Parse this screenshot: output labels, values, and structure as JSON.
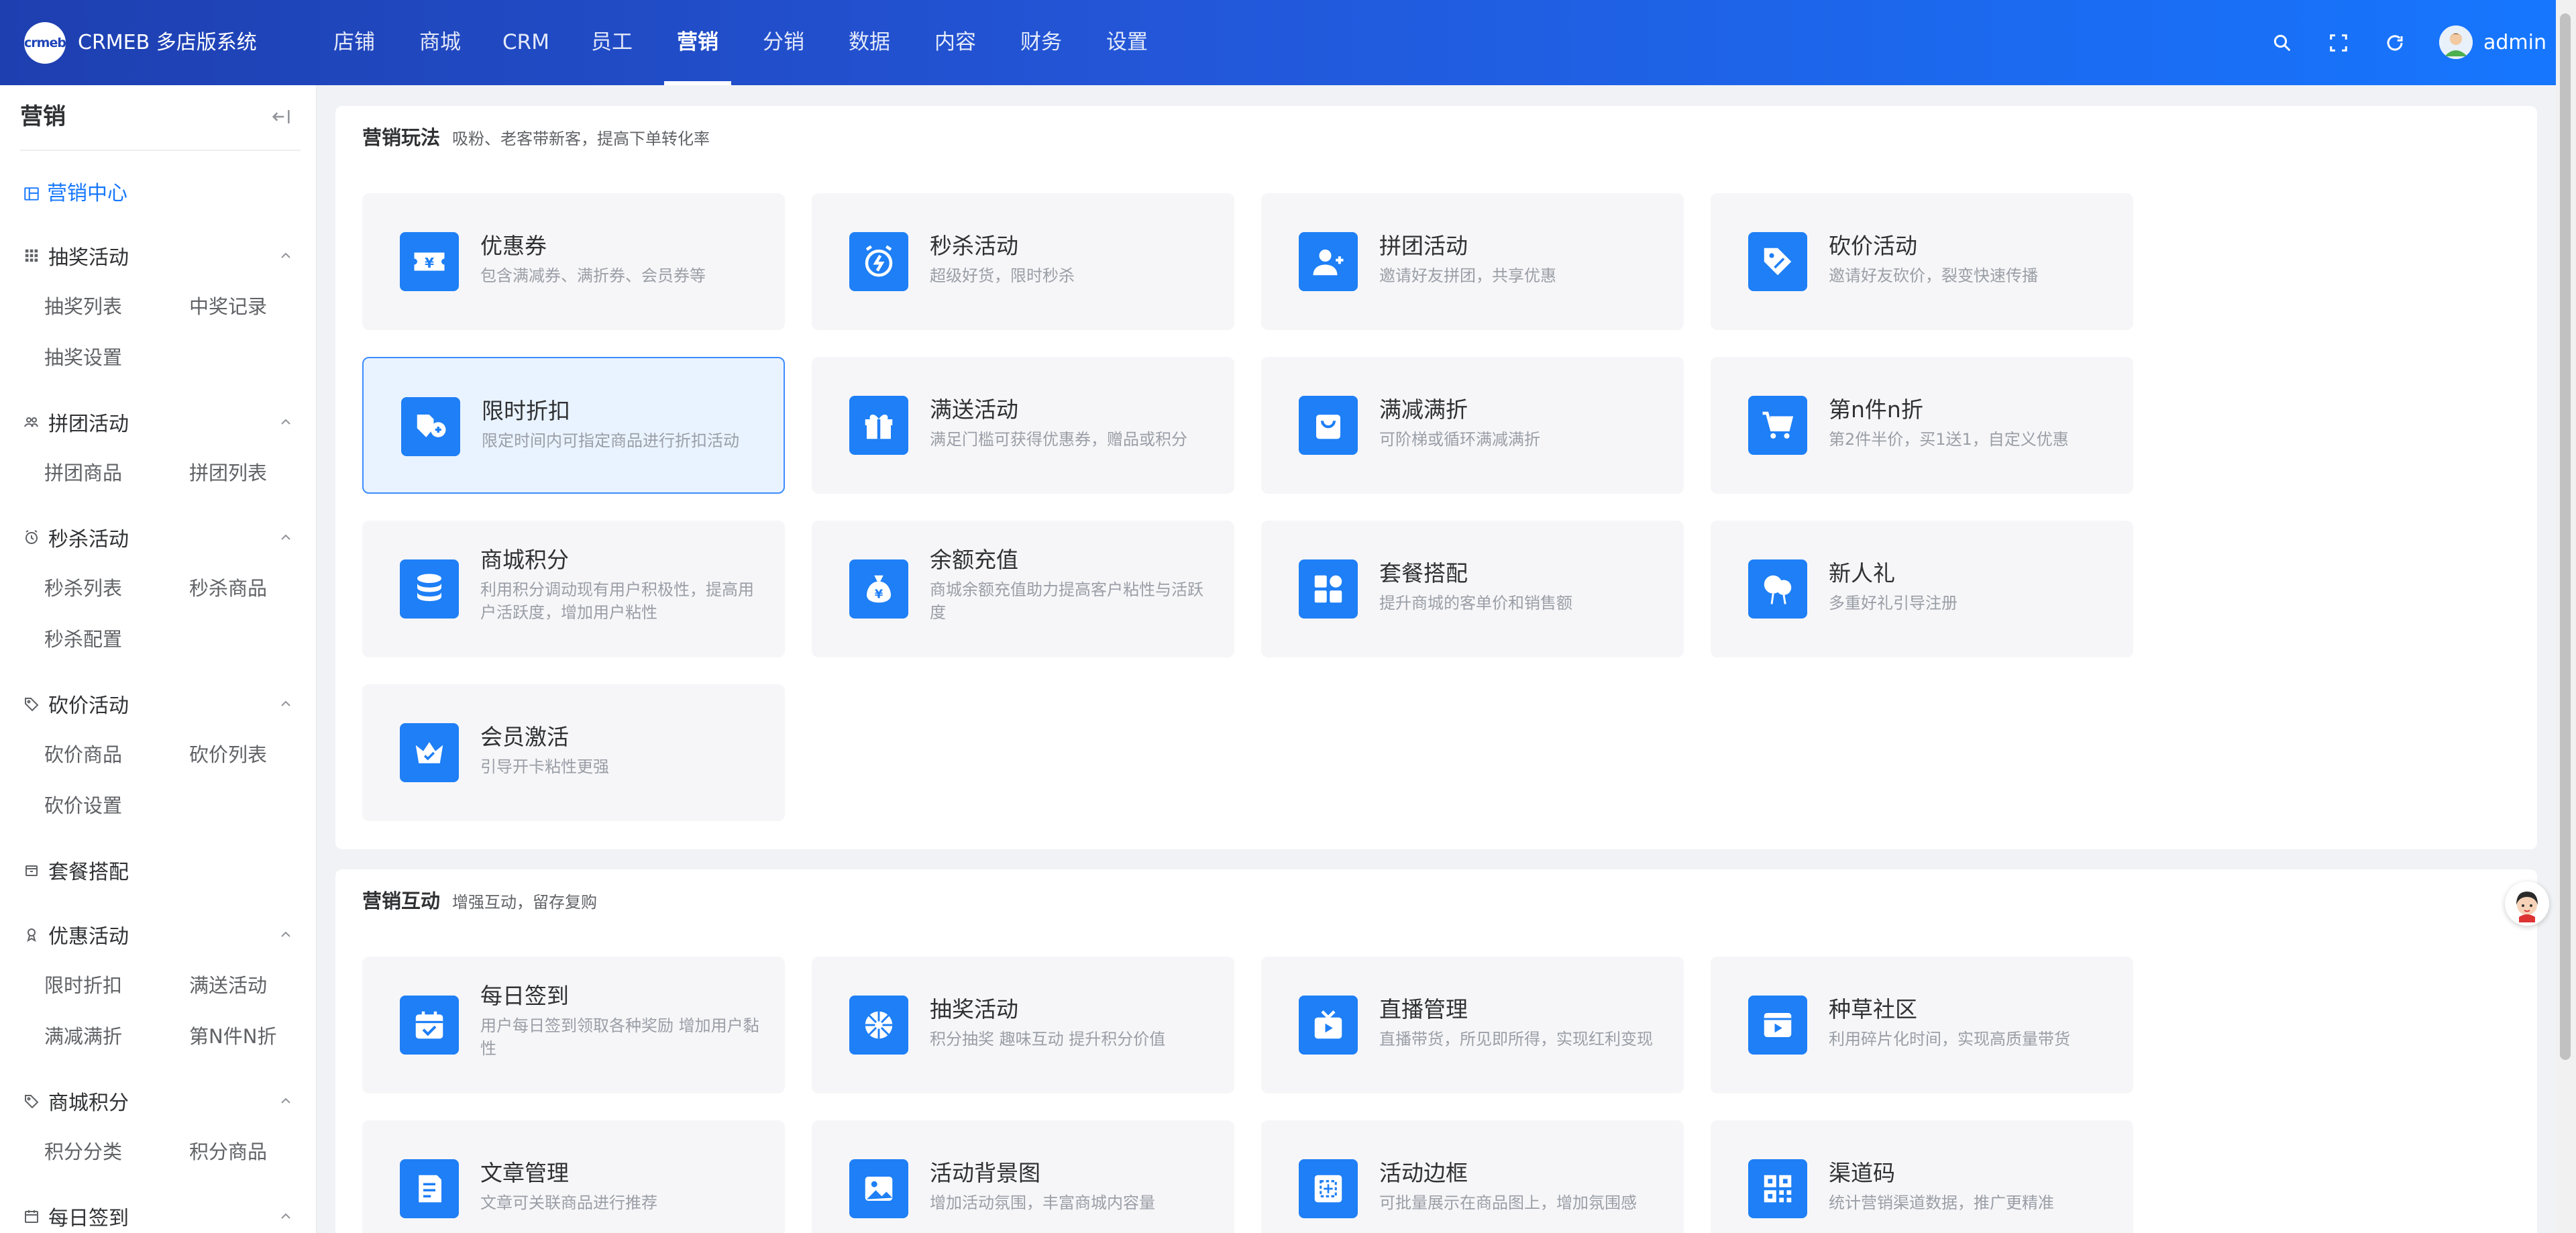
{
  "header": {
    "logo_text": "crmeb",
    "brand": "CRMEB 多店版系统",
    "nav": [
      "店铺",
      "商城",
      "CRM",
      "员工",
      "营销",
      "分销",
      "数据",
      "内容",
      "财务",
      "设置"
    ],
    "active_nav": "营销",
    "username": "admin"
  },
  "sidebar": {
    "title": "营销",
    "home": "营销中心",
    "groups": [
      {
        "label": "抽奖活动",
        "subs": [
          "抽奖列表",
          "中奖记录",
          "抽奖设置"
        ]
      },
      {
        "label": "拼团活动",
        "subs": [
          "拼团商品",
          "拼团列表"
        ]
      },
      {
        "label": "秒杀活动",
        "subs": [
          "秒杀列表",
          "秒杀商品",
          "秒杀配置"
        ]
      },
      {
        "label": "砍价活动",
        "subs": [
          "砍价商品",
          "砍价列表",
          "砍价设置"
        ]
      },
      {
        "label": "套餐搭配",
        "subs": []
      },
      {
        "label": "优惠活动",
        "subs": [
          "限时折扣",
          "满送活动",
          "满减满折",
          "第N件N折"
        ]
      },
      {
        "label": "商城积分",
        "subs": [
          "积分分类",
          "积分商品"
        ]
      },
      {
        "label": "每日签到",
        "subs": []
      }
    ]
  },
  "sections": [
    {
      "title": "营销玩法",
      "desc": "吸粉、老客带新客，提高下单转化率",
      "tiles": [
        {
          "title": "优惠券",
          "desc": "包含满减券、满折券、会员券等",
          "icon": "coupon-icon"
        },
        {
          "title": "秒杀活动",
          "desc": "超级好货，限时秒杀",
          "icon": "alarm-clock-icon"
        },
        {
          "title": "拼团活动",
          "desc": "邀请好友拼团，共享优惠",
          "icon": "group-users-icon"
        },
        {
          "title": "砍价活动",
          "desc": "邀请好友砍价，裂变快速传播",
          "icon": "price-tag-icon"
        },
        {
          "title": "限时折扣",
          "desc": "限定时间内可指定商品进行折扣活动",
          "icon": "discount-tag-icon"
        },
        {
          "title": "满送活动",
          "desc": "满足门槛可获得优惠券，赠品或积分",
          "icon": "gift-icon"
        },
        {
          "title": "满减满折",
          "desc": "可阶梯或循环满减满折",
          "icon": "shopping-bag-icon"
        },
        {
          "title": "第n件n折",
          "desc": "第2件半价，买1送1，自定义优惠",
          "icon": "cart-icon"
        },
        {
          "title": "商城积分",
          "desc": "利用积分调动现有用户积极性，提高用户活跃度，增加用户粘性",
          "icon": "coin-stack-icon"
        },
        {
          "title": "余额充值",
          "desc": "商城余额充值助力提高客户粘性与活跃度",
          "icon": "money-bag-icon"
        },
        {
          "title": "套餐搭配",
          "desc": "提升商城的客单价和销售额",
          "icon": "grid-blocks-icon"
        },
        {
          "title": "新人礼",
          "desc": "多重好礼引导注册",
          "icon": "balloon-icon"
        },
        {
          "title": "会员激活",
          "desc": "引导开卡粘性更强",
          "icon": "crown-icon"
        }
      ]
    },
    {
      "title": "营销互动",
      "desc": "增强互动，留存复购",
      "tiles": [
        {
          "title": "每日签到",
          "desc": "用户每日签到领取各种奖励 增加用户黏性",
          "icon": "calendar-check-icon"
        },
        {
          "title": "抽奖活动",
          "desc": "积分抽奖 趣味互动 提升积分价值",
          "icon": "lottery-wheel-icon"
        },
        {
          "title": "直播管理",
          "desc": "直播带货，所见即所得，实现红利变现",
          "icon": "tv-live-icon"
        },
        {
          "title": "种草社区",
          "desc": "利用碎片化时间，实现高质量带货",
          "icon": "video-play-icon"
        },
        {
          "title": "文章管理",
          "desc": "文章可关联商品进行推荐",
          "icon": "article-icon"
        },
        {
          "title": "活动背景图",
          "desc": "增加活动氛围，丰富商城内容量",
          "icon": "image-icon"
        },
        {
          "title": "活动边框",
          "desc": "可批量展示在商品图上，增加氛围感",
          "icon": "frame-icon"
        },
        {
          "title": "渠道码",
          "desc": "统计营销渠道数据，推广更精准",
          "icon": "qrcode-icon"
        }
      ]
    }
  ],
  "colors": {
    "accent": "#1677ff",
    "tile_icon": "#1e7ff6",
    "tile_bg": "#f6f6f8",
    "selected_bg": "#e9f3ff"
  }
}
